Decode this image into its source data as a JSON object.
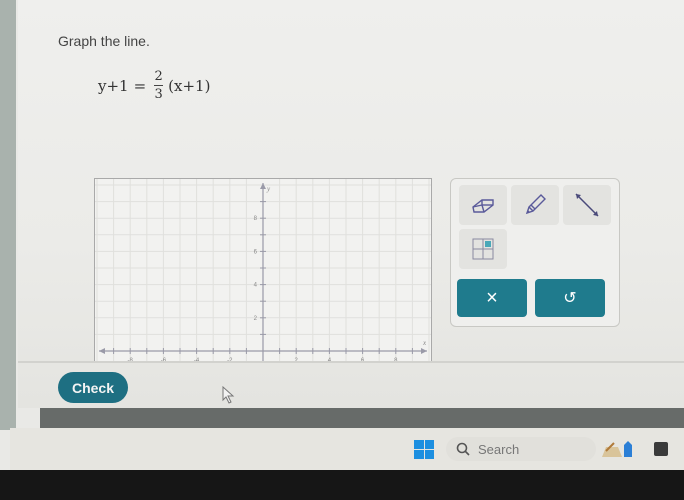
{
  "question": {
    "prompt": "Graph the line.",
    "equation": {
      "lhs": "y+1",
      "equals": "=",
      "numerator": "2",
      "denominator": "3",
      "rhs_factor": "(x+1)"
    }
  },
  "graph": {
    "x_axis_label": "x",
    "y_axis_label": "y",
    "x_range": [
      -10,
      10
    ],
    "y_range": [
      -1,
      10
    ],
    "x_tick_labels": [
      "-8",
      "-6",
      "-4",
      "-2",
      "2",
      "4",
      "6",
      "8"
    ],
    "y_tick_labels": [
      "2",
      "4",
      "6",
      "8"
    ],
    "grid": true
  },
  "tools": {
    "eraser": "eraser-icon",
    "pencil": "pencil-icon",
    "line": "line-segment-icon",
    "point": "point-grid-icon",
    "clear_label": "×",
    "undo_label": "↺"
  },
  "actions": {
    "check_label": "Check"
  },
  "taskbar": {
    "search_placeholder": "Search"
  },
  "colors": {
    "accent": "#1f7b8d",
    "windows_blue": "#1d8fe0"
  }
}
